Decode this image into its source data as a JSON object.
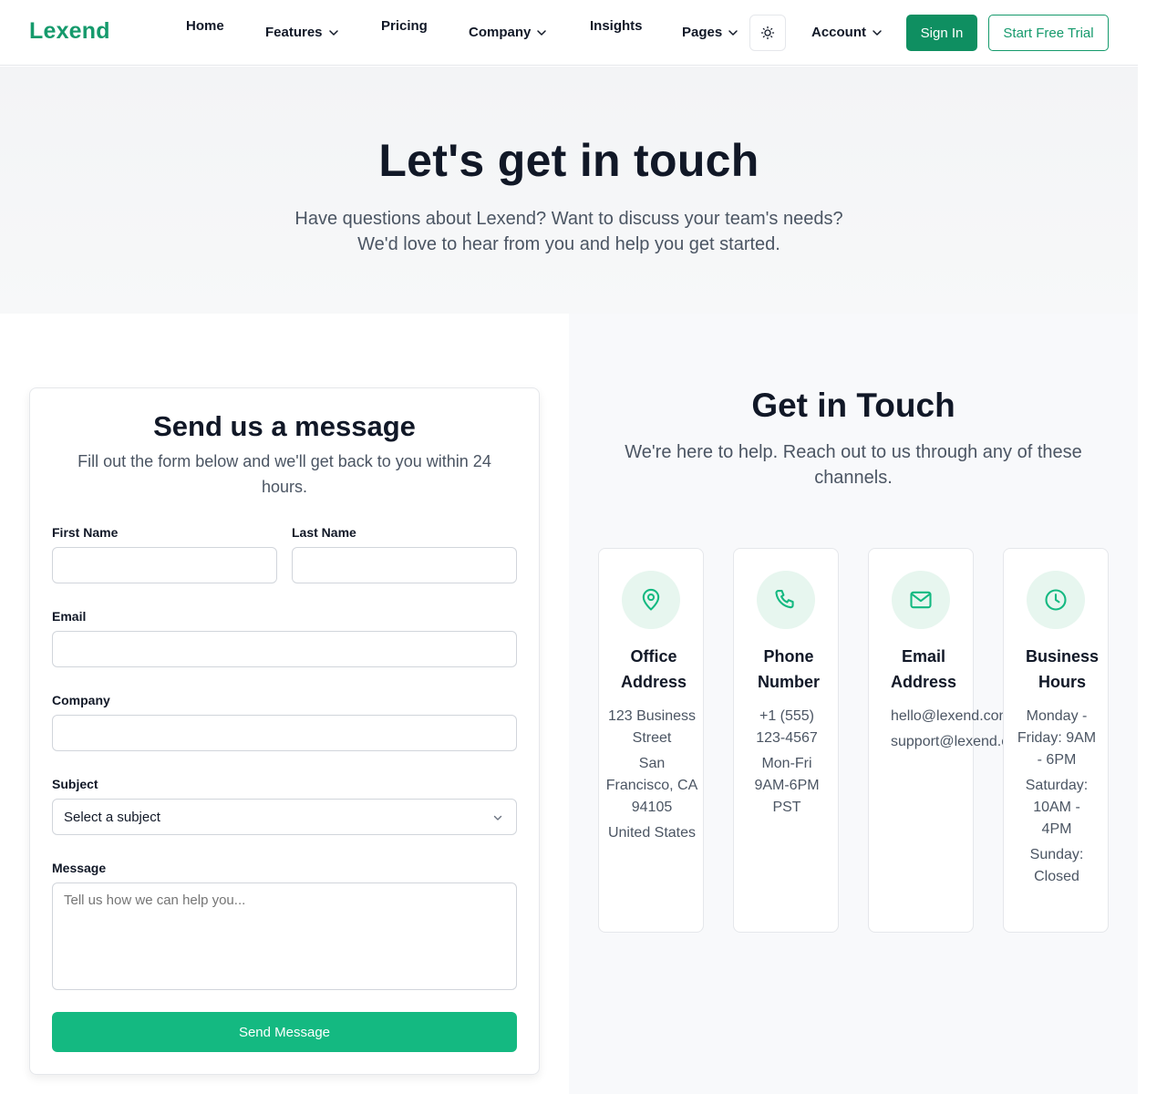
{
  "nav": {
    "logo": "Lexend",
    "items": [
      {
        "label": "Home"
      },
      {
        "label": "Features"
      },
      {
        "label": "Pricing"
      },
      {
        "label": "Company"
      },
      {
        "label": "Insights"
      },
      {
        "label": "Pages"
      },
      {
        "label": "Account"
      }
    ],
    "theme_icon": "sun-icon",
    "sign_in": "Sign In",
    "trial": "Start Free Trial"
  },
  "hero": {
    "title": "Let's get in touch",
    "subtitle_line1": "Have questions about Lexend? Want to discuss your team's needs?",
    "subtitle_line2": "We'd love to hear from you and help you get started."
  },
  "form": {
    "title": "Send us a message",
    "subtitle": "Fill out the form below and we'll get back to you within 24 hours.",
    "first_name_label": "First Name",
    "last_name_label": "Last Name",
    "email_label": "Email",
    "company_label": "Company",
    "subject_label": "Subject",
    "subject_value": "Select a subject",
    "message_label": "Message",
    "message_placeholder": "Tell us how we can help you...",
    "submit": "Send Message"
  },
  "contact": {
    "title": "Get in Touch",
    "subtitle": "We're here to help. Reach out to us through any of these channels.",
    "cards": [
      {
        "icon": "map-pin-icon",
        "title": "Office Address",
        "lines": [
          "123 Business Street",
          "San Francisco, CA 94105",
          "United States"
        ]
      },
      {
        "icon": "phone-icon",
        "title": "Phone Number",
        "lines": [
          "+1 (555) 123-4567",
          "Mon-Fri 9AM-6PM PST"
        ]
      },
      {
        "icon": "mail-icon",
        "title": "Email Address",
        "lines": [
          "hello@lexend.com",
          "support@lexend.com"
        ]
      },
      {
        "icon": "clock-icon",
        "title": "Business Hours",
        "lines": [
          "Monday - Friday: 9AM - 6PM",
          "Saturday: 10AM - 4PM",
          "Sunday: Closed"
        ]
      }
    ]
  },
  "colors": {
    "brand": "#159a6c",
    "accent": "#14b981",
    "icon_bg": "#e7f6ef"
  }
}
